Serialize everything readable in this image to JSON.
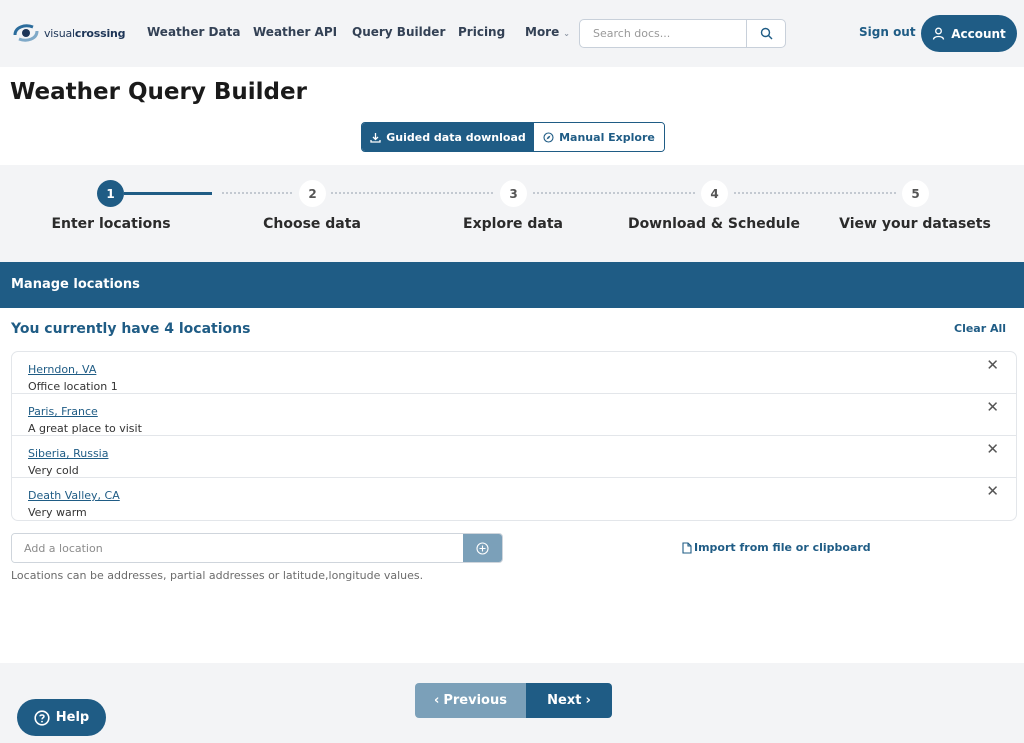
{
  "brand": {
    "name_light": "visual",
    "name_bold": "crossing"
  },
  "nav": {
    "items": [
      "Weather Data",
      "Weather API",
      "Query Builder",
      "Pricing",
      "More"
    ],
    "search_placeholder": "Search docs...",
    "sign_out": "Sign out",
    "account": "Account"
  },
  "page": {
    "title": "Weather Query Builder",
    "modes": {
      "guided": "Guided data download",
      "manual": "Manual Explore",
      "active": "guided"
    }
  },
  "steps": [
    {
      "number": "1",
      "label": "Enter locations",
      "active": true
    },
    {
      "number": "2",
      "label": "Choose data",
      "active": false
    },
    {
      "number": "3",
      "label": "Explore data",
      "active": false
    },
    {
      "number": "4",
      "label": "Download & Schedule",
      "active": false
    },
    {
      "number": "5",
      "label": "View your datasets",
      "active": false
    }
  ],
  "manage": {
    "header": "Manage locations",
    "count_text": "You currently have 4 locations",
    "clear_all": "Clear All",
    "locations": [
      {
        "name": "Herndon, VA",
        "description": "Office location 1"
      },
      {
        "name": "Paris, France",
        "description": "A great place to visit"
      },
      {
        "name": "Siberia, Russia",
        "description": "Very cold"
      },
      {
        "name": "Death Valley, CA",
        "description": "Very warm"
      }
    ],
    "add_placeholder": "Add a location",
    "import_label": "Import from file or clipboard",
    "hint": "Locations can be addresses, partial addresses or latitude,longitude values."
  },
  "footer": {
    "previous": "Previous",
    "next": "Next",
    "help": "Help"
  },
  "colors": {
    "primary": "#1f5c85",
    "muted_button": "#7ba0b9",
    "panel_bg": "#f3f4f6"
  }
}
